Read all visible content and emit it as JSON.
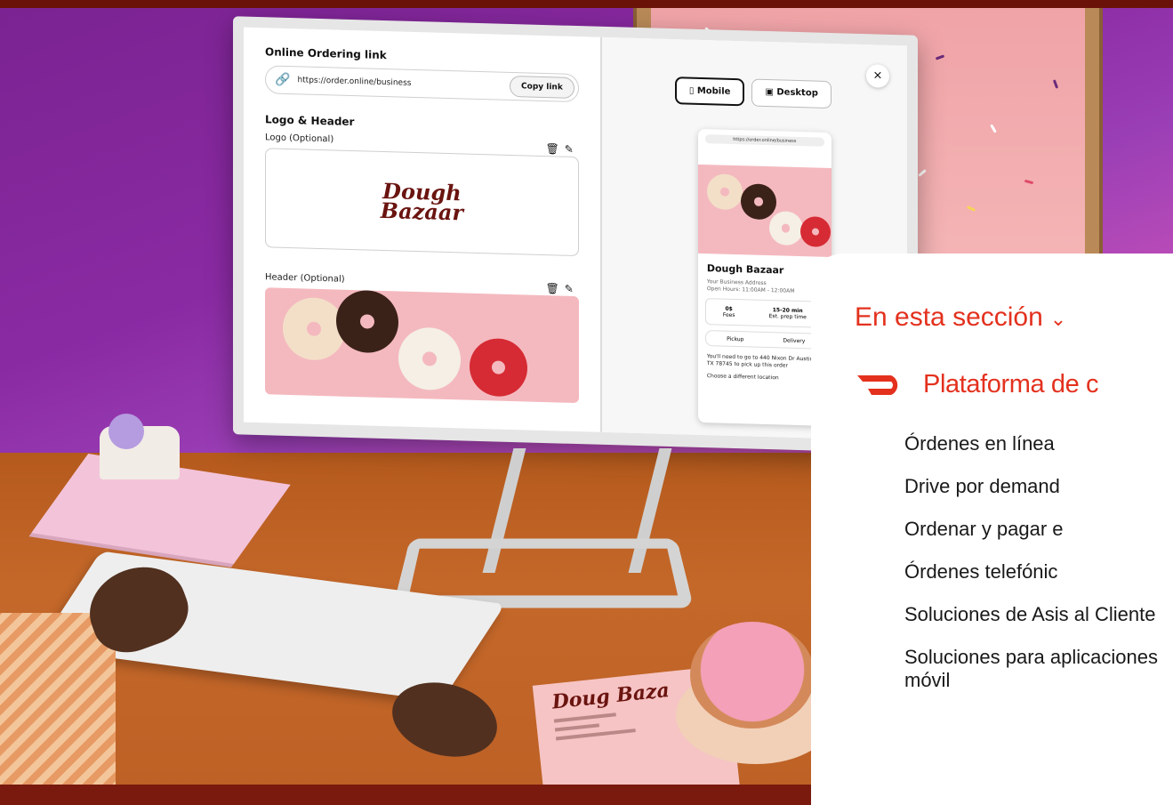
{
  "app": {
    "ordering": {
      "link_label": "Online Ordering link",
      "link_url": "https://order.online/business",
      "copy_label": "Copy link",
      "logo_header_label": "Logo & Header",
      "logo_label": "Logo (Optional)",
      "logo_text_1": "Dough",
      "logo_text_2": "Bazaar",
      "header_label": "Header (Optional)"
    },
    "preview": {
      "mobile_label": "Mobile",
      "desktop_label": "Desktop",
      "close_label": "×",
      "browser_url": "https://order.online/business",
      "store_name": "Dough Bazaar",
      "address_line_1": "Your Business Address",
      "address_line_2": "Open Hours: 11:00AM - 12:00AM",
      "fee_value": "0$",
      "fee_label": "Fees",
      "time_value": "15-20 min",
      "time_label": "Est. prep time",
      "pickup_label": "Pickup",
      "delivery_label": "Delivery",
      "note_line_1": "You'll need to go to 440 Nixon Dr Austin, TX 78745 to pick up this order",
      "note_line_2": "Choose a different location"
    },
    "menu_card": {
      "title": "Doug Baza"
    }
  },
  "panel": {
    "section_title": "En esta sección",
    "platform_title": "Plataforma de c",
    "items": [
      {
        "label": "Órdenes en línea"
      },
      {
        "label": "Drive por demand"
      },
      {
        "label": "Ordenar y pagar e"
      },
      {
        "label": "Órdenes telefónic"
      },
      {
        "label": "Soluciones de Asis al Cliente"
      },
      {
        "label": "Soluciones para aplicaciones móvil"
      }
    ]
  },
  "colors": {
    "accent": "#e3311e",
    "top_bar": "#6b1208",
    "wall": "#8a2aa3",
    "desk": "#c4682a"
  }
}
